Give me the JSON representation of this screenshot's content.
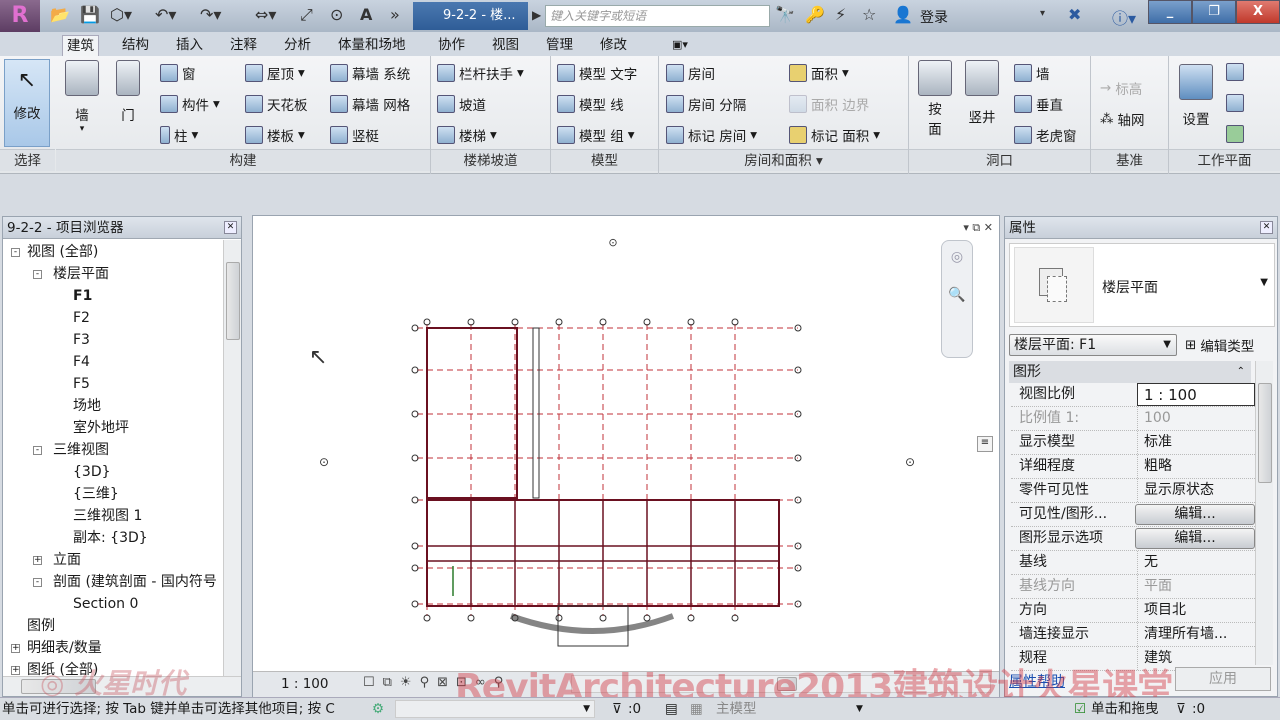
{
  "app": {
    "doc_title": "9-2-2 - 楼...",
    "search_placeholder": "键入关键字或短语",
    "login": "登录",
    "app_button": "R"
  },
  "window": {
    "min": "_",
    "restore": "❐",
    "close": "X"
  },
  "tabs": [
    "建筑",
    "结构",
    "插入",
    "注释",
    "分析",
    "体量和场地",
    "协作",
    "视图",
    "管理",
    "修改"
  ],
  "active_tab": "建筑",
  "ribbon": {
    "modify": "修改",
    "wall": "墙",
    "door": "门",
    "window": "窗",
    "component": "构件",
    "column": "柱",
    "roof": "屋顶",
    "ceiling": "天花板",
    "floor": "楼板",
    "curtain_system": "幕墙 系统",
    "curtain_grid": "幕墙 网格",
    "mullion": "竖梃",
    "railing": "栏杆扶手",
    "ramp": "坡道",
    "stair": "楼梯",
    "model_text": "模型 文字",
    "model_line": "模型 线",
    "model_group": "模型 组",
    "room": "房间",
    "room_separator": "房间 分隔",
    "tag_room": "标记 房间",
    "area": "面积",
    "area_boundary": "面积 边界",
    "tag_area": "标记 面积",
    "by_face_1": "按",
    "by_face_2": "面",
    "shaft": "竖井",
    "opening_wall": "墙",
    "vertical": "垂直",
    "dormer": "老虎窗",
    "level": "标高",
    "grid": "轴网",
    "set": "设置",
    "panels": {
      "select": "选择",
      "build": "构建",
      "circulation": "楼梯坡道",
      "model": "模型",
      "room_area": "房间和面积 ▾",
      "opening": "洞口",
      "datum": "基准",
      "work_plane": "工作平面"
    }
  },
  "browser": {
    "title": "9-2-2 - 项目浏览器",
    "items": [
      {
        "label": "视图 (全部)",
        "level": 0,
        "exp": "-"
      },
      {
        "label": "楼层平面",
        "level": 1,
        "exp": "-"
      },
      {
        "label": "F1",
        "level": 2,
        "bold": true
      },
      {
        "label": "F2",
        "level": 2
      },
      {
        "label": "F3",
        "level": 2
      },
      {
        "label": "F4",
        "level": 2
      },
      {
        "label": "F5",
        "level": 2
      },
      {
        "label": "场地",
        "level": 2
      },
      {
        "label": "室外地坪",
        "level": 2
      },
      {
        "label": "三维视图",
        "level": 1,
        "exp": "-"
      },
      {
        "label": "{3D}",
        "level": 2
      },
      {
        "label": "{三维}",
        "level": 2
      },
      {
        "label": "三维视图 1",
        "level": 2
      },
      {
        "label": "副本: {3D}",
        "level": 2
      },
      {
        "label": "立面",
        "level": 1,
        "exp": "+"
      },
      {
        "label": "剖面 (建筑剖面 - 国内符号",
        "level": 1,
        "exp": "-"
      },
      {
        "label": "Section 0",
        "level": 2
      },
      {
        "label": "图例",
        "level": 0
      },
      {
        "label": "明细表/数量",
        "level": 0,
        "exp": "+"
      },
      {
        "label": "图纸 (全部)",
        "level": 0,
        "exp": "+"
      }
    ]
  },
  "view": {
    "scale": "1 : 100"
  },
  "properties": {
    "title": "属性",
    "type_name": "楼层平面",
    "instance": "楼层平面: F1",
    "edit_type": "编辑类型",
    "group": "图形",
    "rows": [
      {
        "k": "视图比例",
        "v": "1 : 100",
        "boxed": true
      },
      {
        "k": "比例值 1:",
        "v": "100",
        "grey": true
      },
      {
        "k": "显示模型",
        "v": "标准"
      },
      {
        "k": "详细程度",
        "v": "粗略"
      },
      {
        "k": "零件可见性",
        "v": "显示原状态"
      },
      {
        "k": "可见性/图形...",
        "v": "编辑...",
        "btn": true
      },
      {
        "k": "图形显示选项",
        "v": "编辑...",
        "btn": true
      },
      {
        "k": "基线",
        "v": "无"
      },
      {
        "k": "基线方向",
        "v": "平面",
        "grey": true
      },
      {
        "k": "方向",
        "v": "项目北"
      },
      {
        "k": "墙连接显示",
        "v": "清理所有墙..."
      },
      {
        "k": "规程",
        "v": "建筑"
      }
    ],
    "help": "属性帮助",
    "apply": "应用"
  },
  "status": {
    "message": "单击可进行选择; 按 Tab 键并单击可选择其他项目; 按 C",
    "count": ":0",
    "model": "主模型",
    "drag": "单击和拖曳",
    "filter": ":0"
  },
  "watermark": "RevitArchitecture2013建筑设计火星课堂",
  "logo": "火星时代",
  "colors": {
    "active_title": "#2f5d97",
    "grid_line": "#c0303a",
    "wall": "#6a1020"
  }
}
